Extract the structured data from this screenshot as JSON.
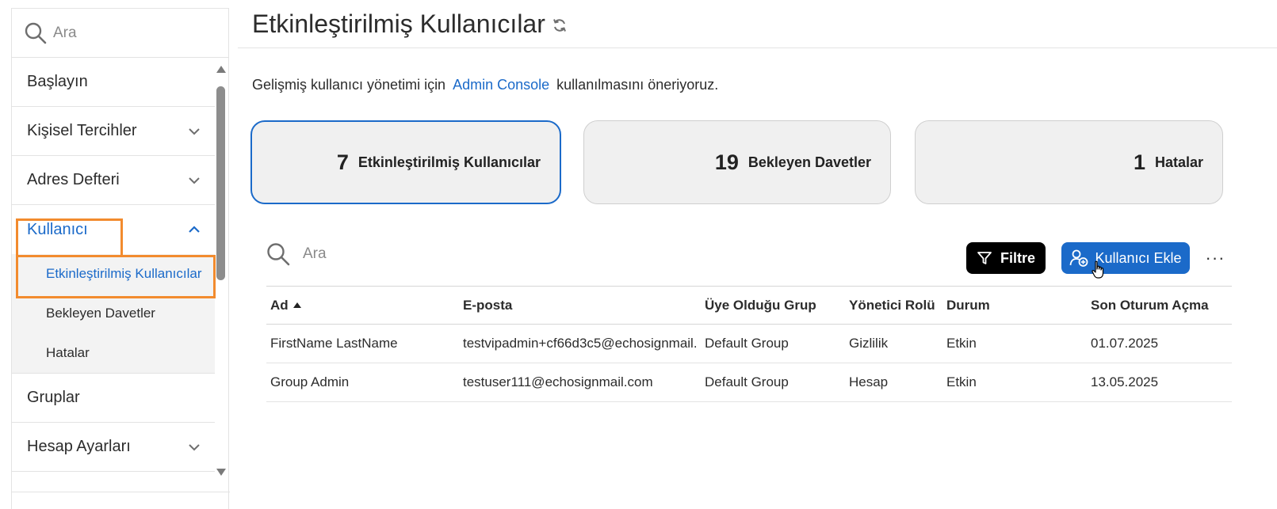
{
  "sidebar": {
    "search_placeholder": "Ara",
    "items": [
      {
        "label": "Başlayın"
      },
      {
        "label": "Kişisel Tercihler"
      },
      {
        "label": "Adres Defteri"
      },
      {
        "label": "Kullanıcı"
      },
      {
        "label": "Gruplar"
      },
      {
        "label": "Hesap Ayarları"
      }
    ],
    "sub_items": [
      {
        "label": "Etkinleştirilmiş Kullanıcılar"
      },
      {
        "label": "Bekleyen Davetler"
      },
      {
        "label": "Hatalar"
      }
    ]
  },
  "header": {
    "title": "Etkinleştirilmiş Kullanıcılar"
  },
  "notice": {
    "prefix": "Gelişmiş kullanıcı yönetimi için",
    "link": "Admin Console",
    "suffix": "kullanılmasını öneriyoruz."
  },
  "cards": [
    {
      "count": "7",
      "label": "Etkinleştirilmiş Kullanıcılar"
    },
    {
      "count": "19",
      "label": "Bekleyen Davetler"
    },
    {
      "count": "1",
      "label": "Hatalar"
    }
  ],
  "toolbar": {
    "search_placeholder": "Ara",
    "filter_label": "Filtre",
    "add_label": "Kullanıcı Ekle",
    "more_label": "···"
  },
  "table": {
    "columns": [
      "Ad",
      "E-posta",
      "Üye Olduğu Grup",
      "Yönetici Rolü",
      "Durum",
      "Son Oturum Açma"
    ],
    "rows": [
      [
        "FirstName LastName",
        "testvipadmin+cf66d3c5@echosignmail....",
        "Default Group",
        "Gizlilik",
        "Etkin",
        "01.07.2025"
      ],
      [
        "Group Admin",
        "testuser111@echosignmail.com",
        "Default Group",
        "Hesap",
        "Etkin",
        "13.05.2025"
      ]
    ]
  },
  "colors": {
    "accent": "#1b6ac9",
    "highlight": "#f28b2e",
    "card_bg": "#f0f0f0"
  }
}
